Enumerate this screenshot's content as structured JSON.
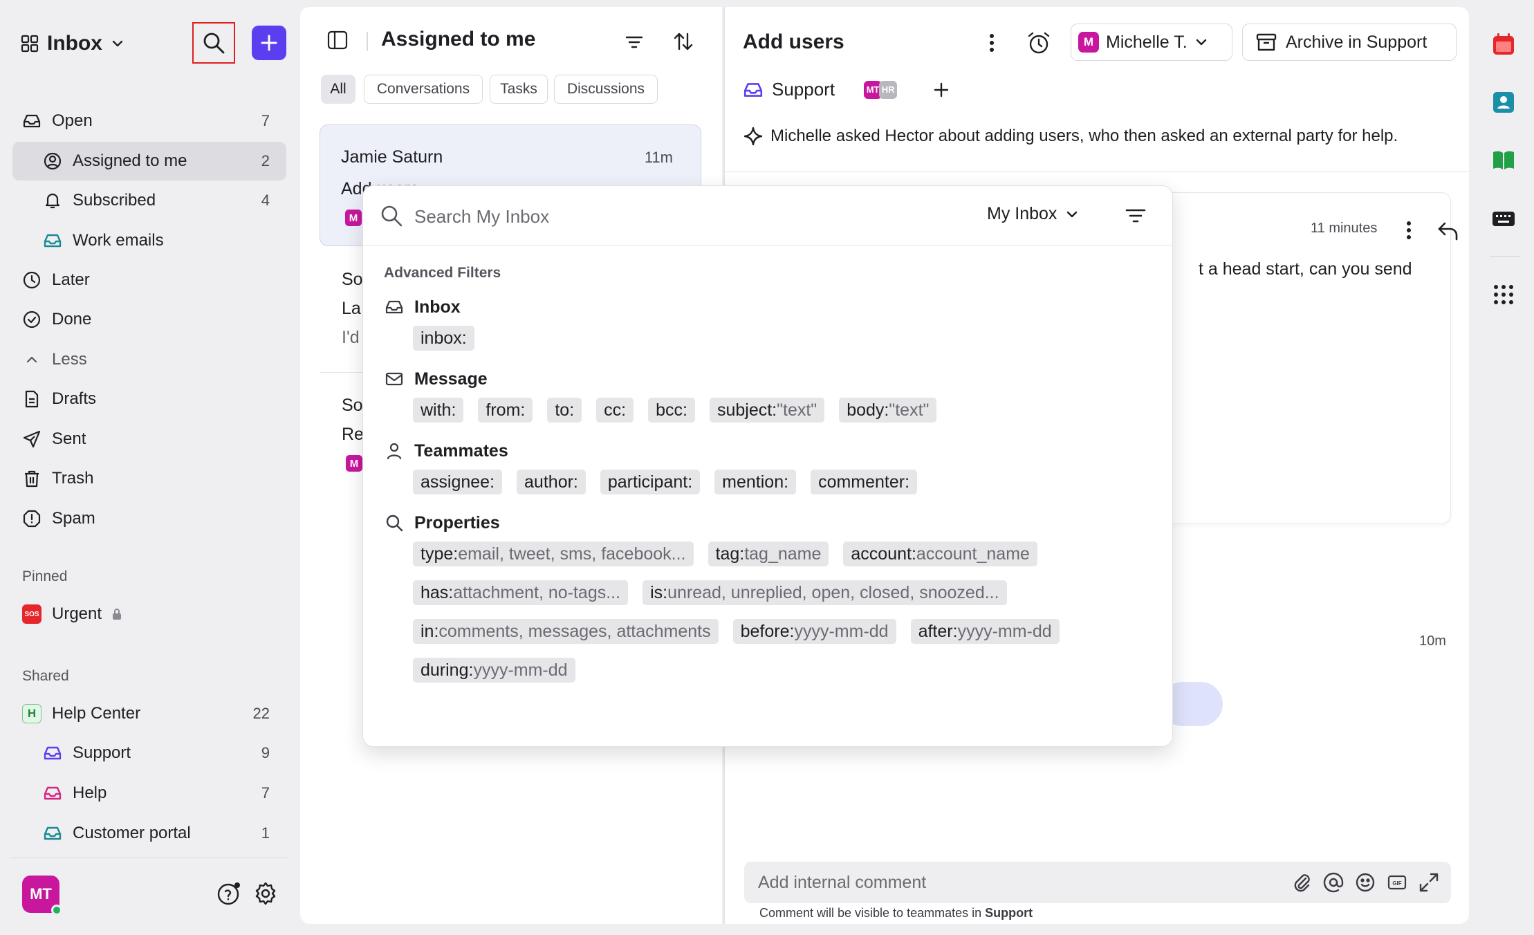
{
  "sidebar": {
    "workspace_title": "Inbox",
    "nav": [
      {
        "label": "Open",
        "count": "7"
      },
      {
        "label": "Assigned to me",
        "count": "2"
      },
      {
        "label": "Subscribed",
        "count": "4"
      },
      {
        "label": "Work emails",
        "count": ""
      },
      {
        "label": "Later",
        "count": ""
      },
      {
        "label": "Done",
        "count": ""
      },
      {
        "label": "Less",
        "count": ""
      },
      {
        "label": "Drafts",
        "count": ""
      },
      {
        "label": "Sent",
        "count": ""
      },
      {
        "label": "Trash",
        "count": ""
      },
      {
        "label": "Spam",
        "count": ""
      }
    ],
    "pinned_label": "Pinned",
    "pinned": [
      {
        "label": "Urgent",
        "badge": "SOS"
      }
    ],
    "shared_label": "Shared",
    "shared": [
      {
        "label": "Help Center",
        "count": "22",
        "badge": "H"
      },
      {
        "label": "Support",
        "count": "9"
      },
      {
        "label": "Help",
        "count": "7"
      },
      {
        "label": "Customer portal",
        "count": "1"
      }
    ],
    "avatar": "MT"
  },
  "list": {
    "title": "Assigned to me",
    "tabs": [
      "All",
      "Conversations",
      "Tasks",
      "Discussions"
    ],
    "selected_tab": "All",
    "card": {
      "from": "Jamie Saturn",
      "time": "11m",
      "subject": "Add users",
      "badge": "M"
    },
    "fragments": [
      "So",
      "La",
      "I'd",
      "So",
      "Re"
    ],
    "badge2": "M"
  },
  "conversation": {
    "title": "Add users",
    "assignee": {
      "initial": "M",
      "name": "Michelle T."
    },
    "archive_label": "Archive in Support",
    "inbox_tag": "Support",
    "participants": [
      "MT",
      "HR"
    ],
    "summary": "Michelle asked Hector about adding users, who then asked an external party for help.",
    "message": {
      "time": "11 minutes",
      "body": "t a head start, can you send"
    },
    "note_time": "10m",
    "comment_placeholder": "Add internal comment",
    "comment_hint_prefix": "Comment will be visible to teammates in ",
    "comment_hint_inbox": "Support"
  },
  "search_popup": {
    "placeholder": "Search My Inbox",
    "scope": "My Inbox",
    "advanced_label": "Advanced Filters",
    "groups": [
      {
        "title": "Inbox",
        "icon": "inbox-icon",
        "rows": [
          [
            {
              "k": "inbox:",
              "h": ""
            }
          ]
        ]
      },
      {
        "title": "Message",
        "icon": "mail-icon",
        "rows": [
          [
            {
              "k": "with:",
              "h": ""
            },
            {
              "k": "from:",
              "h": ""
            },
            {
              "k": "to:",
              "h": ""
            },
            {
              "k": "cc:",
              "h": ""
            },
            {
              "k": "bcc:",
              "h": ""
            },
            {
              "k": "subject:",
              "h": "\"text\""
            },
            {
              "k": "body:",
              "h": "\"text\""
            }
          ]
        ]
      },
      {
        "title": "Teammates",
        "icon": "person-icon",
        "rows": [
          [
            {
              "k": "assignee:",
              "h": ""
            },
            {
              "k": "author:",
              "h": ""
            },
            {
              "k": "participant:",
              "h": ""
            },
            {
              "k": "mention:",
              "h": ""
            },
            {
              "k": "commenter:",
              "h": ""
            }
          ]
        ]
      },
      {
        "title": "Properties",
        "icon": "search-icon",
        "rows": [
          [
            {
              "k": "type:",
              "h": "email, tweet, sms, facebook..."
            },
            {
              "k": "tag:",
              "h": "tag_name"
            },
            {
              "k": "account:",
              "h": "account_name"
            }
          ],
          [
            {
              "k": "has:",
              "h": "attachment, no-tags..."
            },
            {
              "k": "is:",
              "h": "unread, unreplied, open, closed, snoozed..."
            }
          ],
          [
            {
              "k": "in:",
              "h": "comments, messages, attachments"
            },
            {
              "k": "before:",
              "h": "yyyy-mm-dd"
            },
            {
              "k": "after:",
              "h": "yyyy-mm-dd"
            }
          ],
          [
            {
              "k": "during:",
              "h": "yyyy-mm-dd"
            }
          ]
        ]
      }
    ]
  },
  "colors": {
    "accent": "#5b3ef0",
    "brand_pink": "#c8179d",
    "highlight_red": "#e01e1e"
  }
}
